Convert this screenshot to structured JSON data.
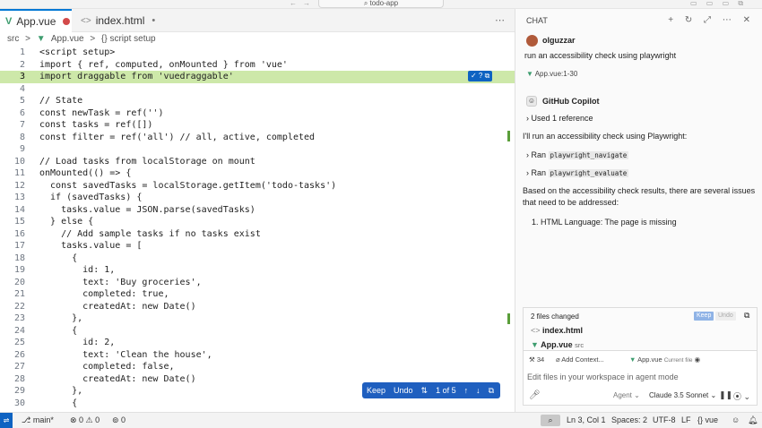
{
  "titlebar": {
    "search_label": "todo-app",
    "nav_back": "←",
    "nav_forward": "→",
    "layout_icons": "▭ ▭ ▭ ⧉"
  },
  "tabs": [
    {
      "label": "App.vue",
      "icon": "V"
    },
    {
      "label": "index.html",
      "icon": "<>"
    }
  ],
  "tab_actions": "⋯",
  "breadcrumb": {
    "folder": "src",
    "sep1": ">",
    "file": "App.vue",
    "sep2": ">",
    "symbol": "{} script setup"
  },
  "editor": {
    "line_numbers": [
      "1",
      "2",
      "3",
      "4",
      "5",
      "6",
      "7",
      "8",
      "9",
      "10",
      "11",
      "12",
      "13",
      "14",
      "15",
      "16",
      "17",
      "18",
      "19",
      "20",
      "21",
      "22",
      "23",
      "24",
      "25",
      "26",
      "27",
      "28",
      "29",
      "30"
    ],
    "lines": [
      "<script setup>",
      "import { ref, computed, onMounted } from 'vue'",
      "import draggable from 'vuedraggable'",
      "",
      "// State",
      "const newTask = ref('')",
      "const tasks = ref([])",
      "const filter = ref('all') // all, active, completed",
      "",
      "// Load tasks from localStorage on mount",
      "onMounted(() => {",
      "  const savedTasks = localStorage.getItem('todo-tasks')",
      "  if (savedTasks) {",
      "    tasks.value = JSON.parse(savedTasks)",
      "  } else {",
      "    // Add sample tasks if no tasks exist",
      "    tasks.value = [",
      "      {",
      "        id: 1,",
      "        text: 'Buy groceries',",
      "        completed: true,",
      "        createdAt: new Date()",
      "      },",
      "      {",
      "        id: 2,",
      "        text: 'Clean the house',",
      "        completed: false,",
      "        createdAt: new Date()",
      "      },",
      "      {"
    ],
    "inline_actions": "✓ ? ⧉"
  },
  "keepbar": {
    "keep": "Keep",
    "undo": "Undo",
    "counter": "1 of 5",
    "up": "↑",
    "down": "↓",
    "open": "⧉"
  },
  "chat": {
    "header": "CHAT",
    "header_actions": "+ ↻ ⤢ ⋯ ✕",
    "user_name": "olguzzar",
    "user_message": "run an accessibility check using playwright",
    "reference_chip": "App.vue:1-30",
    "assistant_name": "GitHub Copilot",
    "used_reference": "Used 1 reference",
    "intro": "I'll run an accessibility check using Playwright:",
    "tool1_prefix": "Ran",
    "tool1": "playwright_navigate",
    "tool2_prefix": "Ran",
    "tool2": "playwright_evaluate",
    "result_line1": "Based on the accessibility check results, there are several issues",
    "result_line2": "that need to be addressed:",
    "list_item": "1. HTML Language: The page is missing",
    "files_changed": "2 files changed",
    "keep": "Keep",
    "undo": "Undo",
    "file1": "index.html",
    "file2": "App.vue",
    "file2_dir": "src",
    "tools_count": "34",
    "add_context": "Add Context...",
    "context_file": "App.vue",
    "context_file_note": "Current file",
    "input_placeholder": "Edit files in your workspace in agent mode",
    "mode": "Agent",
    "model": "Claude 3.5 Sonnet"
  },
  "statusbar": {
    "branch": "main*",
    "problems": "⊗ 0 ⚠ 0",
    "ports": "0",
    "position": "Ln 3, Col 1",
    "spaces": "Spaces: 2",
    "encoding": "UTF-8",
    "eol": "LF",
    "language": "vue"
  },
  "colors": {
    "accent": "#0078d4",
    "diff_highlight": "#cde8a9",
    "keep_bar": "#1f5fbf"
  }
}
